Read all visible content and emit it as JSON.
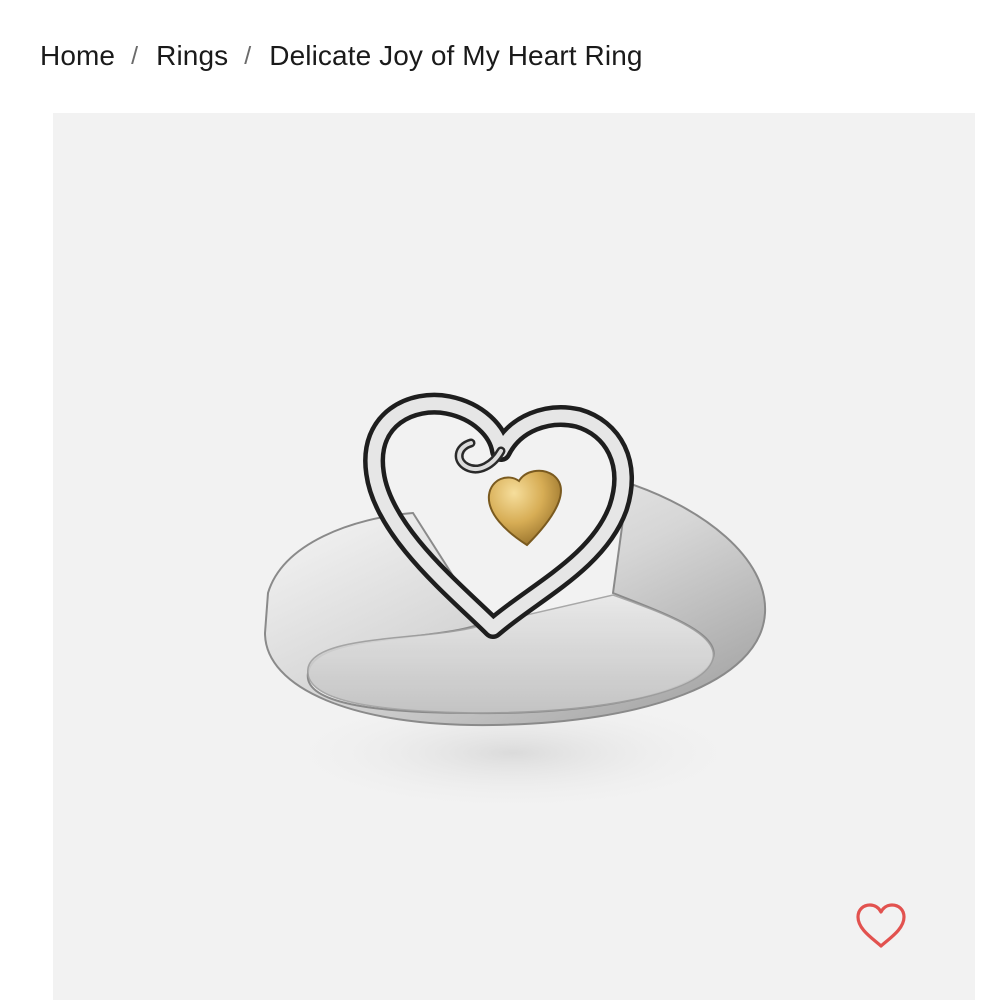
{
  "breadcrumb": {
    "items": [
      {
        "label": "Home"
      },
      {
        "label": "Rings"
      }
    ],
    "separator": "/",
    "current": "Delicate Joy of My Heart Ring"
  },
  "product": {
    "image": {
      "subject": "ring",
      "band_metal": "sterling silver",
      "heart_charm_metal": "gold"
    },
    "wishlist": {
      "icon": "heart-outline-icon",
      "icon_color": "#e2524f"
    }
  },
  "colors": {
    "background": "#ffffff",
    "image_background": "#f2f2f2",
    "text": "#1a1a1a",
    "separator": "#6b6b6b"
  }
}
